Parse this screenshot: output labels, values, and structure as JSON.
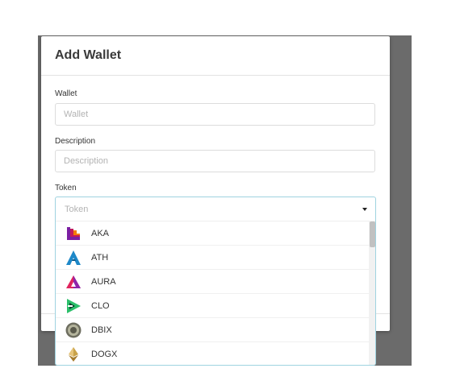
{
  "modal": {
    "title": "Add Wallet",
    "fields": {
      "wallet": {
        "label": "Wallet",
        "placeholder": "Wallet",
        "value": ""
      },
      "description": {
        "label": "Description",
        "placeholder": "Description",
        "value": ""
      },
      "token": {
        "label": "Token",
        "placeholder": "Token"
      }
    }
  },
  "token_options": [
    {
      "label": "AKA",
      "icon": "aka-logo-icon"
    },
    {
      "label": "ATH",
      "icon": "ath-logo-icon"
    },
    {
      "label": "AURA",
      "icon": "aura-logo-icon"
    },
    {
      "label": "CLO",
      "icon": "clo-logo-icon"
    },
    {
      "label": "DBIX",
      "icon": "dbix-logo-icon"
    },
    {
      "label": "DOGX",
      "icon": "dogx-logo-icon"
    }
  ],
  "colors": {
    "overlay": "#6b6b6b",
    "focus_border": "#9fd3e0",
    "aka_primary": "#c2185b",
    "ath_primary": "#1e88c8",
    "aura_primary": "#e0245e",
    "clo_primary": "#2bbf6a",
    "dbix_primary": "#8a8a7a",
    "dogx_primary": "#c9a24a"
  }
}
